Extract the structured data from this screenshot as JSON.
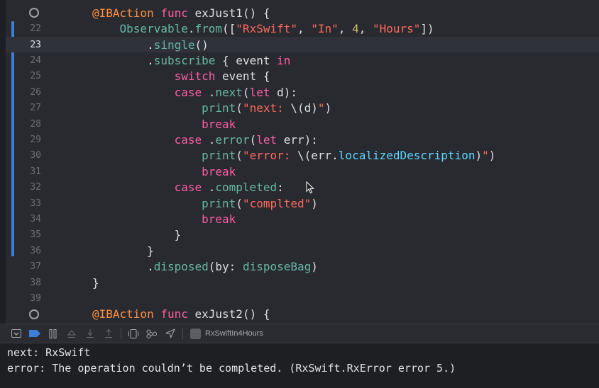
{
  "editor": {
    "lines": [
      {
        "n": "",
        "marker": true
      },
      {
        "n": "22"
      },
      {
        "n": "23",
        "current": true
      },
      {
        "n": "24"
      },
      {
        "n": "25"
      },
      {
        "n": "26"
      },
      {
        "n": "27"
      },
      {
        "n": "28"
      },
      {
        "n": "29"
      },
      {
        "n": "30"
      },
      {
        "n": "31"
      },
      {
        "n": "32"
      },
      {
        "n": "33"
      },
      {
        "n": "34"
      },
      {
        "n": "35"
      },
      {
        "n": "36"
      },
      {
        "n": "37"
      },
      {
        "n": "38"
      },
      {
        "n": "39"
      },
      {
        "n": "",
        "marker": true
      }
    ],
    "code": [
      [
        {
          "t": "@IBAction",
          "c": "attr"
        },
        {
          "t": " "
        },
        {
          "t": "func",
          "c": "kw"
        },
        {
          "t": " exJust1() {"
        }
      ],
      [
        {
          "t": "    "
        },
        {
          "t": "Observable",
          "c": "grn"
        },
        {
          "t": "."
        },
        {
          "t": "from",
          "c": "grn"
        },
        {
          "t": "(["
        },
        {
          "t": "\"RxSwift\"",
          "c": "str"
        },
        {
          "t": ", "
        },
        {
          "t": "\"In\"",
          "c": "str"
        },
        {
          "t": ", "
        },
        {
          "t": "4",
          "c": "num"
        },
        {
          "t": ", "
        },
        {
          "t": "\"Hours\"",
          "c": "str"
        },
        {
          "t": "])"
        }
      ],
      [
        {
          "t": "        ."
        },
        {
          "t": "single",
          "c": "grn"
        },
        {
          "t": "()"
        }
      ],
      [
        {
          "t": "        ."
        },
        {
          "t": "subscribe",
          "c": "grn"
        },
        {
          "t": " { event "
        },
        {
          "t": "in",
          "c": "kw"
        }
      ],
      [
        {
          "t": "            "
        },
        {
          "t": "switch",
          "c": "kw"
        },
        {
          "t": " event {"
        }
      ],
      [
        {
          "t": "            "
        },
        {
          "t": "case",
          "c": "kw"
        },
        {
          "t": " ."
        },
        {
          "t": "next",
          "c": "grn"
        },
        {
          "t": "("
        },
        {
          "t": "let",
          "c": "kw"
        },
        {
          "t": " d):"
        }
      ],
      [
        {
          "t": "                "
        },
        {
          "t": "print",
          "c": "grn"
        },
        {
          "t": "("
        },
        {
          "t": "\"next: ",
          "c": "str"
        },
        {
          "t": "\\("
        },
        {
          "t": "d"
        },
        {
          "t": ")"
        },
        {
          "t": "\"",
          "c": "str"
        },
        {
          "t": ")"
        }
      ],
      [
        {
          "t": "                "
        },
        {
          "t": "break",
          "c": "kw"
        }
      ],
      [
        {
          "t": "            "
        },
        {
          "t": "case",
          "c": "kw"
        },
        {
          "t": " ."
        },
        {
          "t": "error",
          "c": "grn"
        },
        {
          "t": "("
        },
        {
          "t": "let",
          "c": "kw"
        },
        {
          "t": " err):"
        }
      ],
      [
        {
          "t": "                "
        },
        {
          "t": "print",
          "c": "grn"
        },
        {
          "t": "("
        },
        {
          "t": "\"error: ",
          "c": "str"
        },
        {
          "t": "\\("
        },
        {
          "t": "err."
        },
        {
          "t": "localizedDescription",
          "c": "typ"
        },
        {
          "t": ")"
        },
        {
          "t": "\"",
          "c": "str"
        },
        {
          "t": ")"
        }
      ],
      [
        {
          "t": "                "
        },
        {
          "t": "break",
          "c": "kw"
        }
      ],
      [
        {
          "t": "            "
        },
        {
          "t": "case",
          "c": "kw"
        },
        {
          "t": " ."
        },
        {
          "t": "completed",
          "c": "grn"
        },
        {
          "t": ":"
        }
      ],
      [
        {
          "t": "                "
        },
        {
          "t": "print",
          "c": "grn"
        },
        {
          "t": "("
        },
        {
          "t": "\"complted\"",
          "c": "str"
        },
        {
          "t": ")"
        }
      ],
      [
        {
          "t": "                "
        },
        {
          "t": "break",
          "c": "kw"
        }
      ],
      [
        {
          "t": "            }"
        }
      ],
      [
        {
          "t": "        }"
        }
      ],
      [
        {
          "t": "        ."
        },
        {
          "t": "disposed",
          "c": "grn"
        },
        {
          "t": "(by: "
        },
        {
          "t": "disposeBag",
          "c": "grn"
        },
        {
          "t": ")"
        }
      ],
      [
        {
          "t": "}"
        }
      ],
      [
        {
          "t": ""
        }
      ],
      [
        {
          "t": "@IBAction",
          "c": "attr"
        },
        {
          "t": " "
        },
        {
          "t": "func",
          "c": "kw"
        },
        {
          "t": " exJust2() {"
        }
      ]
    ]
  },
  "toolbar": {
    "icons": [
      "hide-debug-area-icon",
      "breakpoints-toggle-icon",
      "pause-icon",
      "step-over-icon",
      "step-into-icon",
      "step-out-icon",
      "view-hierarchy-icon",
      "memory-graph-icon",
      "simulate-location-icon"
    ],
    "target_label": "RxSwiftIn4Hours"
  },
  "console": {
    "lines": [
      "next: RxSwift",
      "error: The operation couldn’t be completed. (RxSwift.RxError error 5.)"
    ]
  },
  "colors": {
    "editor_bg": "#292a30",
    "keyword": "#fc5fa3",
    "attribute": "#fd8f3f",
    "string": "#fc6a5d",
    "number": "#d0bf69",
    "function": "#67b7a4",
    "type": "#5dd8ff",
    "change_bar": "#3b80d6"
  }
}
